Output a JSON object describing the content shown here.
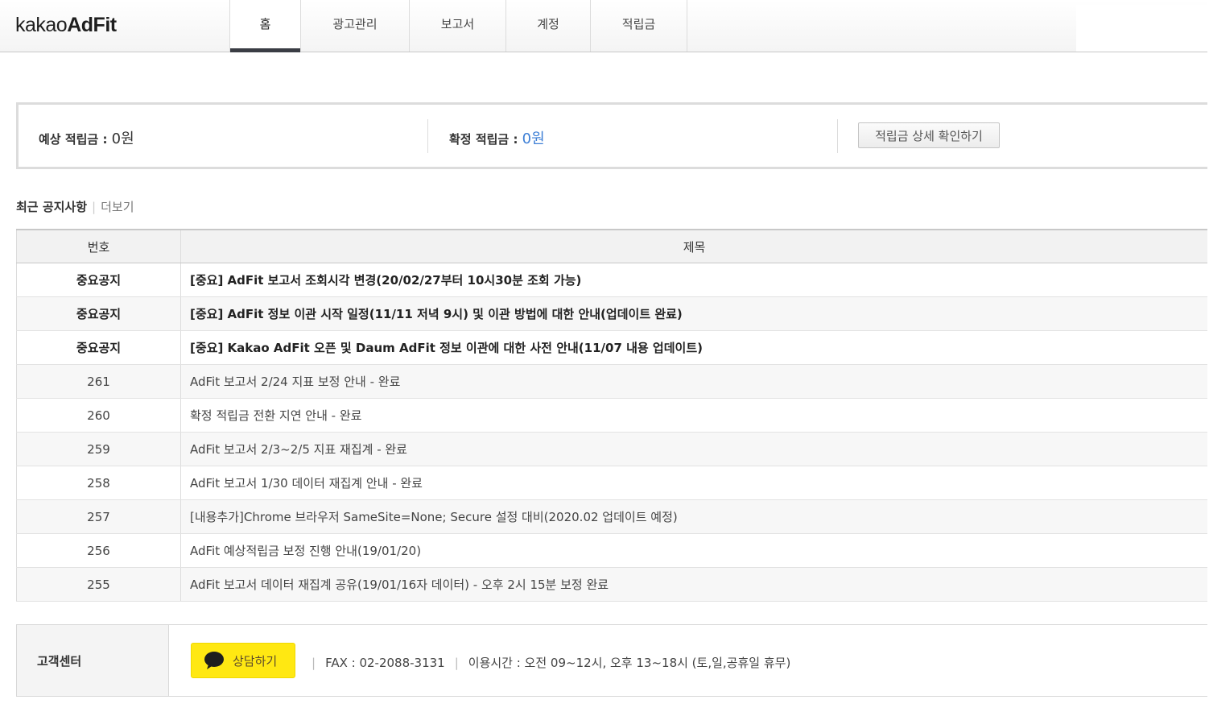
{
  "brand": {
    "part1": "kakao",
    "part2": "AdFit"
  },
  "nav": [
    {
      "label": "홈",
      "active": true
    },
    {
      "label": "광고관리"
    },
    {
      "label": "보고서"
    },
    {
      "label": "계정"
    },
    {
      "label": "적립금"
    }
  ],
  "summary": {
    "expected_label": "예상 적립금 : ",
    "expected_value": "0원",
    "confirmed_label": "확정 적립금 : ",
    "confirmed_value": "0원",
    "detail_button": "적립금 상세 확인하기"
  },
  "notices": {
    "title": "최근 공지사항",
    "more": "더보기",
    "headers": [
      "번호",
      "제목"
    ],
    "rows": [
      {
        "no": "중요공지",
        "title": "[중요] AdFit 보고서 조회시각 변경(20/02/27부터 10시30분 조회 가능)",
        "important": true
      },
      {
        "no": "중요공지",
        "title": "[중요] AdFit 정보 이관 시작 일정(11/11 저녁 9시) 및 이관 방법에 대한 안내(업데이트 완료)",
        "important": true
      },
      {
        "no": "중요공지",
        "title": "[중요] Kakao AdFit 오픈 및 Daum AdFit 정보 이관에 대한 사전 안내(11/07 내용 업데이트)",
        "important": true
      },
      {
        "no": "261",
        "title": "AdFit 보고서 2/24 지표 보정 안내 - 완료"
      },
      {
        "no": "260",
        "title": "확정 적립금 전환 지연 안내 - 완료"
      },
      {
        "no": "259",
        "title": "AdFit 보고서 2/3~2/5 지표 재집계 - 완료"
      },
      {
        "no": "258",
        "title": "AdFit 보고서 1/30 데이터 재집계 안내 - 완료"
      },
      {
        "no": "257",
        "title": "[내용추가]Chrome 브라우저 SameSite=None; Secure 설정 대비(2020.02 업데이트 예정)"
      },
      {
        "no": "256",
        "title": "AdFit 예상적립금 보정 진행 안내(19/01/20)"
      },
      {
        "no": "255",
        "title": "AdFit 보고서 데이터 재집계 공유(19/01/16자 데이터) - 오후 2시 15분 보정 완료"
      }
    ]
  },
  "customer_center": {
    "label": "고객센터",
    "chat_button": "상담하기",
    "fax": "FAX : 02-2088-3131",
    "hours": "이용시간 : 오전 09~12시, 오후 13~18시 (토,일,공휴일 휴무)"
  },
  "colors": {
    "accent_blue": "#3d7fd6",
    "kakao_yellow": "#ffe812",
    "nav_active_bar": "#3a3d44"
  },
  "icons": {
    "chat": "speech-bubble-icon"
  }
}
